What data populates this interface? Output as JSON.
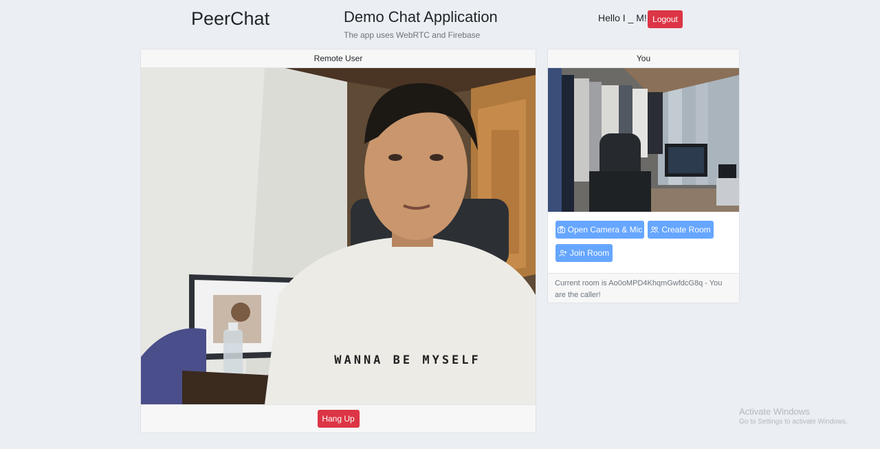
{
  "header": {
    "brand": "PeerChat",
    "title": "Demo Chat Application",
    "subtitle": "The app uses WebRTC and Firebase",
    "greeting": "Hello I _ M!",
    "logout_label": "Logout"
  },
  "remote": {
    "header": "Remote User",
    "shirt_text": "WANNA BE MYSELF",
    "hangup_label": "Hang Up"
  },
  "local": {
    "header": "You",
    "open_camera_label": "Open Camera & Mic",
    "create_room_label": "Create Room",
    "join_room_label": "Join Room",
    "room_status": "Current room is Ao0oMPD4KhqmGwfdcG8q - You are the caller!"
  },
  "watermark": {
    "title": "Activate Windows",
    "subtitle": "Go to Settings to activate Windows."
  },
  "icons": {
    "camera": "camera-icon",
    "people": "people-icon",
    "person_add": "person-add-icon"
  },
  "colors": {
    "danger": "#dc3545",
    "primary": "#66a6ff",
    "background": "#ebeef2"
  }
}
